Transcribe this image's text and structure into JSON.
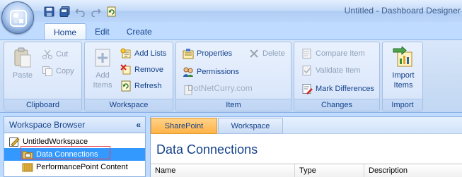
{
  "window": {
    "title": "Untitled - Dashboard Designer"
  },
  "quick_access": {
    "icons": [
      "save-icon",
      "save-all-icon",
      "undo-icon",
      "redo-icon",
      "refresh-icon"
    ]
  },
  "ribbon_tabs": [
    {
      "label": "Home",
      "active": true
    },
    {
      "label": "Edit",
      "active": false
    },
    {
      "label": "Create",
      "active": false
    }
  ],
  "groups": {
    "clipboard": {
      "label": "Clipboard",
      "paste": "Paste",
      "cut": "Cut",
      "copy": "Copy"
    },
    "workspace": {
      "label": "Workspace",
      "add_items_line1": "Add",
      "add_items_line2": "Items",
      "add_lists": "Add Lists",
      "remove": "Remove",
      "refresh": "Refresh"
    },
    "item": {
      "label": "Item",
      "properties": "Properties",
      "permissions": "Permissions",
      "delete": "Delete"
    },
    "changes": {
      "label": "Changes",
      "compare_item": "Compare Item",
      "validate_item": "Validate Item",
      "mark_differences": "Mark Differences"
    },
    "import": {
      "label": "Import",
      "import_items_line1": "Import",
      "import_items_line2": "Items"
    }
  },
  "watermark": "DotNetCurry.com",
  "workspace_browser": {
    "title": "Workspace Browser",
    "collapse": "«",
    "tree": [
      {
        "label": "UntitledWorkspace",
        "icon": "workspace-icon"
      },
      {
        "label": "Data Connections",
        "icon": "data-connections-icon",
        "selected": true
      },
      {
        "label": "PerformancePoint Content",
        "icon": "content-icon"
      }
    ]
  },
  "main": {
    "tabs": [
      {
        "label": "SharePoint",
        "active": true
      },
      {
        "label": "Workspace",
        "active": false
      }
    ],
    "title": "Data Connections",
    "columns": [
      "Name",
      "Type",
      "Description"
    ]
  },
  "colors": {
    "accent": "#15428b",
    "ribbon_bg": "#c1d8f4",
    "selection": "#3399ff",
    "active_doc_tab": "#ffb347"
  }
}
